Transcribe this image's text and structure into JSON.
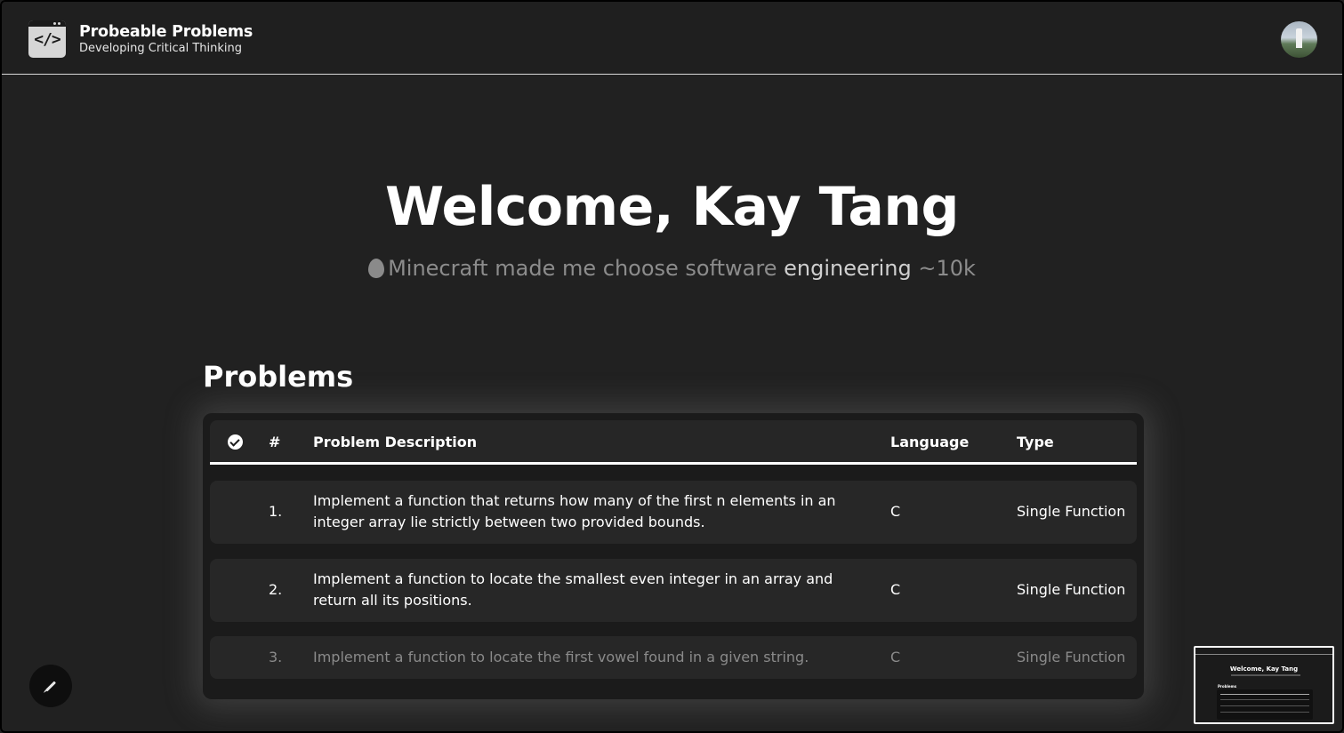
{
  "header": {
    "title": "Probeable Problems",
    "subtitle": "Developing Critical Thinking",
    "logo_icon": "code-window-icon",
    "avatar_icon": "user-avatar"
  },
  "hero": {
    "welcome": "Welcome, Kay Tang",
    "tagline_start": "Minecraft made me choose software ",
    "tagline_mid": "engineering",
    "tagline_end": " ~10k",
    "tagline_icon": "egg-icon"
  },
  "problems": {
    "title": "Problems",
    "columns": {
      "status": "check-circle-icon",
      "number": "#",
      "description": "Problem Description",
      "language": "Language",
      "type": "Type"
    },
    "rows": [
      {
        "number": "1.",
        "description_line1": "Implement a function that returns how many of the first n elements in an",
        "description_line2": "integer array lie strictly between two provided bounds.",
        "language": "C",
        "type": "Single Function"
      },
      {
        "number": "2.",
        "description_line1": "Implement a function to locate the smallest even integer in an array and",
        "description_line2": "return all its positions.",
        "language": "C",
        "type": "Single Function"
      },
      {
        "number": "3.",
        "description_line1": "Implement a function to locate the first vowel found in a given string.",
        "description_line2": "",
        "language": "C",
        "type": "Single Function"
      }
    ]
  },
  "floating": {
    "edit_icon": "pencil-icon"
  },
  "minimap": {
    "title": "Welcome, Kay Tang",
    "problems": "Problems"
  },
  "colors": {
    "background": "#212121",
    "header_border": "#d9d9d9",
    "row_bg": "#272727",
    "faded_text": "#8a8a8a"
  }
}
